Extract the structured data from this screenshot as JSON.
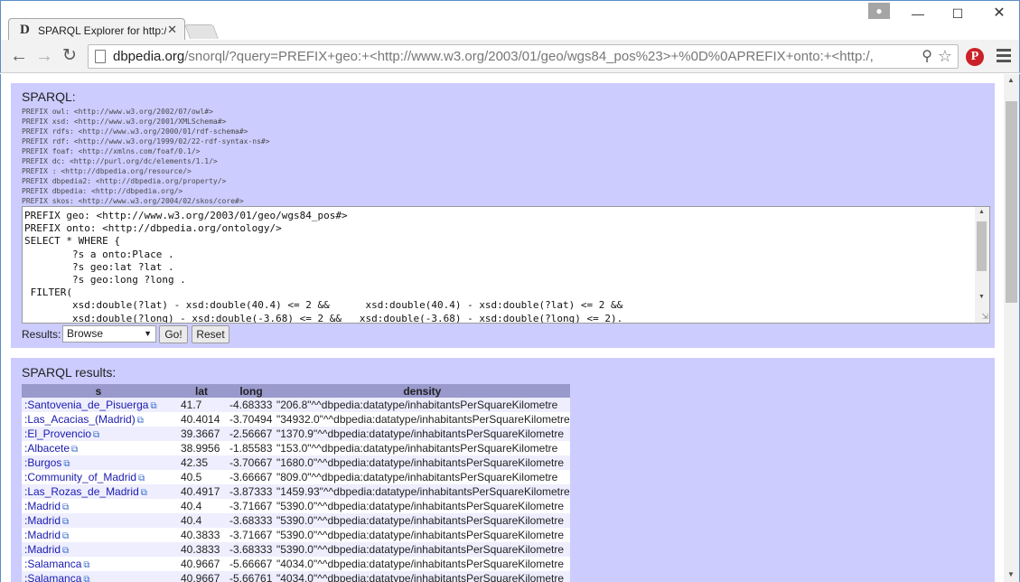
{
  "browser": {
    "tab": {
      "favicon": "D",
      "title": "SPARQL Explorer for http:/",
      "close": "✕"
    },
    "window": {
      "profile_icon": "person-icon",
      "minimize": "—",
      "maximize": "☐",
      "close": "✕"
    },
    "url": {
      "host": "dbpedia.org",
      "rest": "/snorql/?query=PREFIX+geo:+<http://www.w3.org/2003/01/geo/wgs84_pos%23>+%0D%0APREFIX+onto:+<http:/,"
    }
  },
  "sparql": {
    "title": "SPARQL:",
    "prefixes": "PREFIX owl: <http://www.w3.org/2002/07/owl#>\nPREFIX xsd: <http://www.w3.org/2001/XMLSchema#>\nPREFIX rdfs: <http://www.w3.org/2000/01/rdf-schema#>\nPREFIX rdf: <http://www.w3.org/1999/02/22-rdf-syntax-ns#>\nPREFIX foaf: <http://xmlns.com/foaf/0.1/>\nPREFIX dc: <http://purl.org/dc/elements/1.1/>\nPREFIX : <http://dbpedia.org/resource/>\nPREFIX dbpedia2: <http://dbpedia.org/property/>\nPREFIX dbpedia: <http://dbpedia.org/>\nPREFIX skos: <http://www.w3.org/2004/02/skos/core#>",
    "query": "PREFIX geo: <http://www.w3.org/2003/01/geo/wgs84_pos#>\nPREFIX onto: <http://dbpedia.org/ontology/>\nSELECT * WHERE {\n        ?s a onto:Place .\n        ?s geo:lat ?lat .\n        ?s geo:long ?long .\n FILTER(\n        xsd:double(?lat) - xsd:double(40.4) <= 2 &&      xsd:double(40.4) - xsd:double(?lat) <= 2 &&\n        xsd:double(?long) - xsd:double(-3.68) <= 2 &&   xsd:double(-3.68) - xsd:double(?long) <= 2).",
    "results_label": "Results:",
    "results_format": "Browse",
    "go_label": "Go!",
    "reset_label": "Reset"
  },
  "results": {
    "title": "SPARQL results:",
    "columns": [
      "s",
      "lat",
      "long",
      "density"
    ],
    "rows": [
      {
        "s": ":Santovenia_de_Pisuerga",
        "lat": "41.7",
        "long": "-4.68333",
        "density": "\"206.8\"^^dbpedia:datatype/inhabitantsPerSquareKilometre"
      },
      {
        "s": ":Las_Acacias_(Madrid)",
        "lat": "40.4014",
        "long": "-3.70494",
        "density": "\"34932.0\"^^dbpedia:datatype/inhabitantsPerSquareKilometre"
      },
      {
        "s": ":El_Provencio",
        "lat": "39.3667",
        "long": "-2.56667",
        "density": "\"1370.9\"^^dbpedia:datatype/inhabitantsPerSquareKilometre"
      },
      {
        "s": ":Albacete",
        "lat": "38.9956",
        "long": "-1.85583",
        "density": "\"153.0\"^^dbpedia:datatype/inhabitantsPerSquareKilometre"
      },
      {
        "s": ":Burgos",
        "lat": "42.35",
        "long": "-3.70667",
        "density": "\"1680.0\"^^dbpedia:datatype/inhabitantsPerSquareKilometre"
      },
      {
        "s": ":Community_of_Madrid",
        "lat": "40.5",
        "long": "-3.66667",
        "density": "\"809.0\"^^dbpedia:datatype/inhabitantsPerSquareKilometre"
      },
      {
        "s": ":Las_Rozas_de_Madrid",
        "lat": "40.4917",
        "long": "-3.87333",
        "density": "\"1459.93\"^^dbpedia:datatype/inhabitantsPerSquareKilometre"
      },
      {
        "s": ":Madrid",
        "lat": "40.4",
        "long": "-3.71667",
        "density": "\"5390.0\"^^dbpedia:datatype/inhabitantsPerSquareKilometre"
      },
      {
        "s": ":Madrid",
        "lat": "40.4",
        "long": "-3.68333",
        "density": "\"5390.0\"^^dbpedia:datatype/inhabitantsPerSquareKilometre"
      },
      {
        "s": ":Madrid",
        "lat": "40.3833",
        "long": "-3.71667",
        "density": "\"5390.0\"^^dbpedia:datatype/inhabitantsPerSquareKilometre"
      },
      {
        "s": ":Madrid",
        "lat": "40.3833",
        "long": "-3.68333",
        "density": "\"5390.0\"^^dbpedia:datatype/inhabitantsPerSquareKilometre"
      },
      {
        "s": ":Salamanca",
        "lat": "40.9667",
        "long": "-5.66667",
        "density": "\"4034.0\"^^dbpedia:datatype/inhabitantsPerSquareKilometre"
      },
      {
        "s": ":Salamanca",
        "lat": "40.9667",
        "long": "-5.66761",
        "density": "\"4034.0\"^^dbpedia:datatype/inhabitantsPerSquareKilometre"
      }
    ]
  },
  "icons": {
    "back": "←",
    "forward": "→",
    "reload": "↻",
    "zoom": "🔍",
    "star": "☆",
    "pinterest": "P",
    "external": "⧉"
  }
}
